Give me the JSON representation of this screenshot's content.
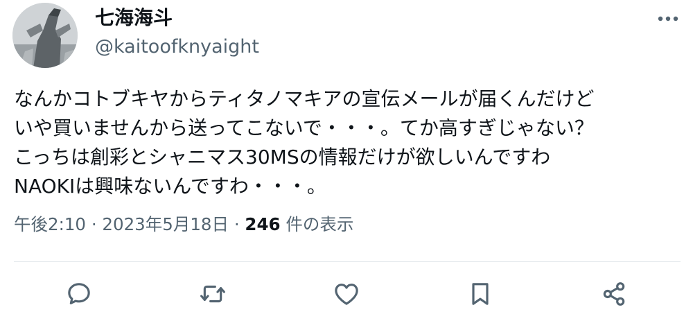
{
  "author": {
    "display_name": "七海海斗",
    "handle": "@kaitoofknyaight"
  },
  "tweet": {
    "lines": [
      "なんかコトブキヤからティタノマキアの宣伝メールが届くんだけど",
      "いや買いませんから送ってこないで・・・。てか高すぎじゃない？",
      "こっちは創彩とシャニマス30MSの情報だけが欲しいんですわ",
      "NAOKIは興味ないんですわ・・・。"
    ]
  },
  "meta": {
    "time": "午後2:10",
    "separator": " · ",
    "date": "2023年5月18日",
    "views_count": "246",
    "views_label": " 件の表示"
  },
  "icons": {
    "more": "more-icon",
    "reply": "reply-icon",
    "retweet": "retweet-icon",
    "like": "like-icon",
    "bookmark": "bookmark-icon",
    "share": "share-icon"
  },
  "colors": {
    "text": "#0f1419",
    "secondary": "#536471",
    "divider": "#e1e6ea",
    "icon": "#536471"
  }
}
